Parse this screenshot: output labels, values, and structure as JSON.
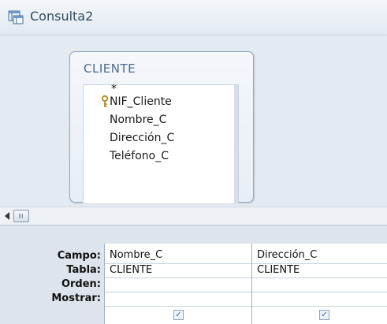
{
  "window": {
    "title": "Consulta2"
  },
  "table_box": {
    "title": "CLIENTE",
    "fields": [
      "*",
      "NIF_Cliente",
      "Nombre_C",
      "Dirección_C",
      "Teléfono_C"
    ],
    "primary_key_field": "NIF_Cliente"
  },
  "grid": {
    "row_labels": [
      "Campo:",
      "Tabla:",
      "Orden:",
      "Mostrar:"
    ],
    "columns": [
      {
        "campo": "Nombre_C",
        "tabla": "CLIENTE",
        "orden": "",
        "mostrar": true
      },
      {
        "campo": "Dirección_C",
        "tabla": "CLIENTE",
        "orden": "",
        "mostrar": true
      }
    ],
    "checkmark": "✓"
  },
  "colors": {
    "accent": "#3264a8",
    "title_text": "#34495e",
    "table_title": "#4b6a8b"
  }
}
